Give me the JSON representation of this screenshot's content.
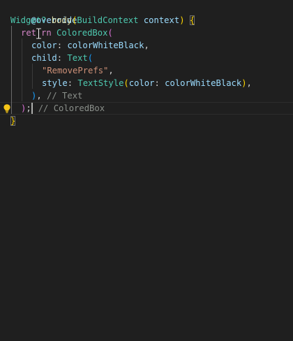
{
  "code": {
    "annotation": "@override",
    "sig": {
      "type": "Widget?",
      "method": "body",
      "param_type": "BuildContext",
      "param_name": "context"
    },
    "ret": {
      "kw_prefix": "ret",
      "kw_suffix": "rn",
      "class": "ColoredBox"
    },
    "color_line": {
      "key": "color",
      "value": "colorWhiteBlack"
    },
    "child_line": {
      "key": "child",
      "class": "Text"
    },
    "string_line": "\"RemovePrefs\"",
    "style_line": {
      "key": "style",
      "class": "TextStyle",
      "inner_key": "color",
      "inner_value": "colorWhiteBlack"
    },
    "text_close_comment": "// Text",
    "box_close_comment": "// ColoredBox"
  },
  "colors": {
    "background": "#1f1f1f",
    "keyword": "#d486c8",
    "type": "#4ec9b0",
    "function": "#dcdcaa",
    "variable": "#9cdcfe",
    "string": "#ce9178",
    "comment": "#8a8f8a",
    "bracket_gold": "#ffd700",
    "bracket_orchid": "#da70d6",
    "bracket_blue": "#179fff"
  },
  "icons": {
    "lightbulb": "lightbulb-icon",
    "text_cursor": "text-cursor-ibeam-icon"
  }
}
